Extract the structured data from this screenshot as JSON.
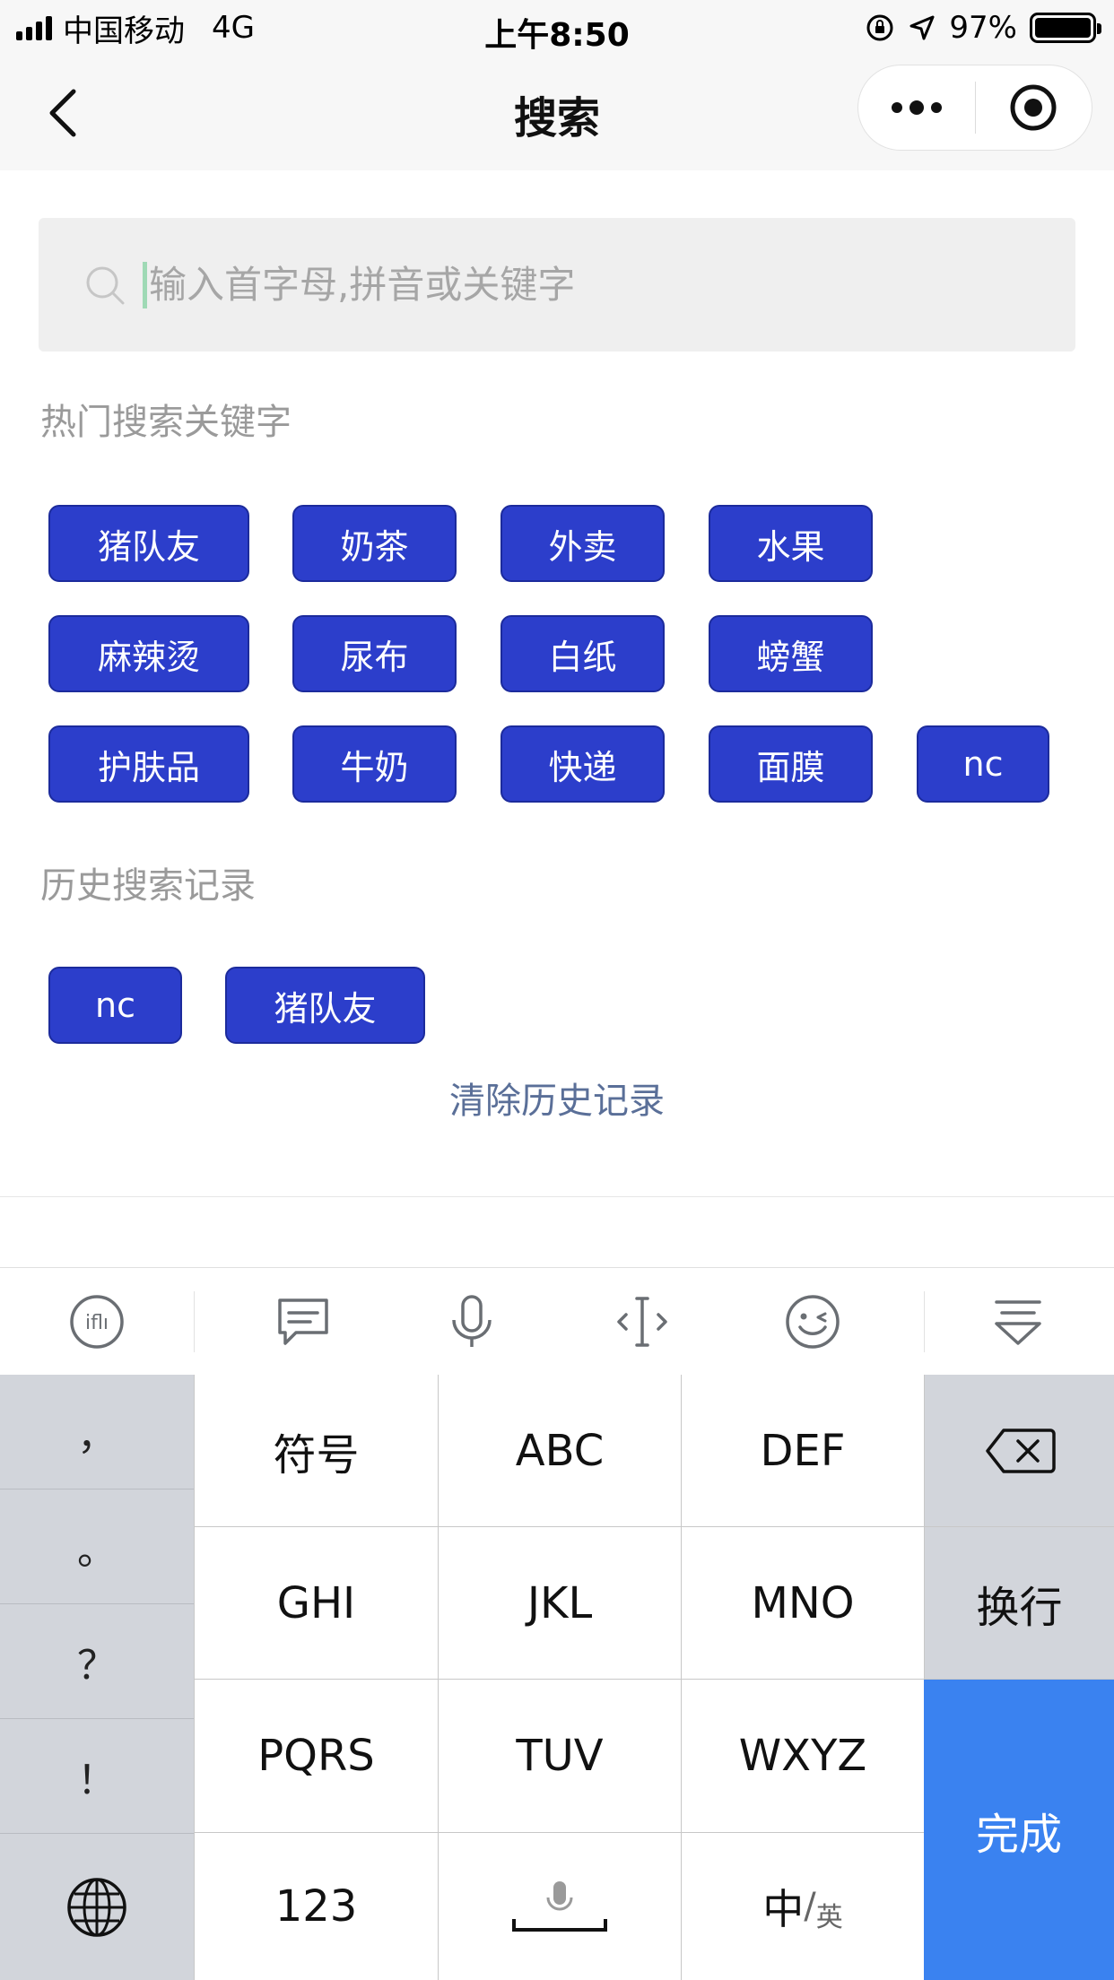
{
  "status_bar": {
    "carrier": "中国移动",
    "network": "4G",
    "time": "上午8:50",
    "battery": "97%"
  },
  "nav": {
    "title": "搜索"
  },
  "search": {
    "placeholder": "输入首字母,拼音或关键字"
  },
  "hot": {
    "title": "热门搜索关键字",
    "tags": [
      "猪队友",
      "奶茶",
      "外卖",
      "水果",
      "麻辣烫",
      "尿布",
      "白纸",
      "螃蟹",
      "护肤品",
      "牛奶",
      "快递",
      "面膜",
      "nc"
    ]
  },
  "history": {
    "title": "历史搜索记录",
    "tags": [
      "nc",
      "猪队友"
    ],
    "clear_label": "清除历史记录"
  },
  "keyboard": {
    "punct": [
      "，",
      "。",
      "？",
      "！"
    ],
    "keys": {
      "symbols": "符号",
      "abc": "ABC",
      "def": "DEF",
      "ghi": "GHI",
      "jkl": "JKL",
      "mno": "MNO",
      "pqrs": "PQRS",
      "tuv": "TUV",
      "wxyz": "WXYZ",
      "newline": "换行",
      "num": "123",
      "lang_main": "中",
      "lang_sep": "/",
      "lang_alt": "英",
      "done": "完成"
    },
    "accent": "#3a82f0"
  }
}
